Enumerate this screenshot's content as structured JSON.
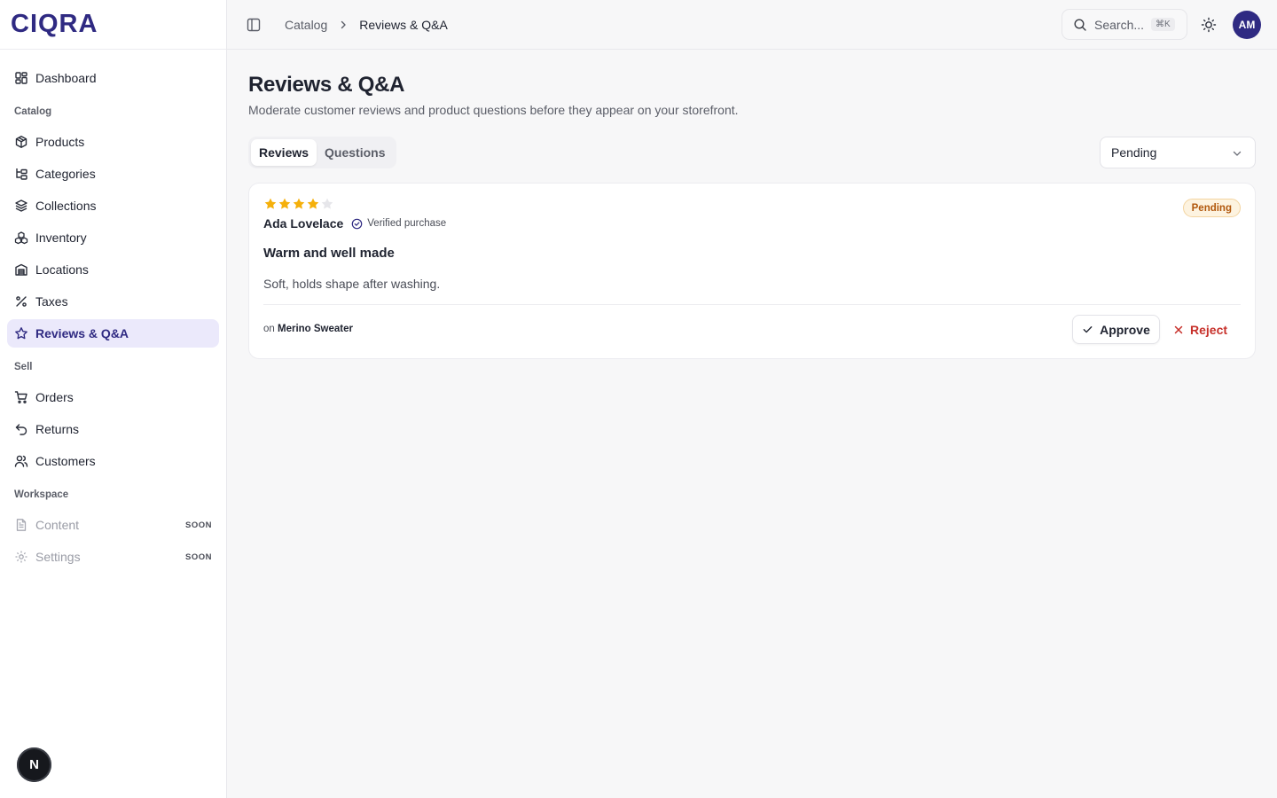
{
  "brand": {
    "logo": "CIQRA"
  },
  "sidebar": {
    "dashboard": "Dashboard",
    "sections": {
      "catalog": "Catalog",
      "sell": "Sell",
      "workspace": "Workspace"
    },
    "catalog_items": {
      "products": "Products",
      "categories": "Categories",
      "collections": "Collections",
      "inventory": "Inventory",
      "locations": "Locations",
      "taxes": "Taxes",
      "reviews": "Reviews & Q&A"
    },
    "sell_items": {
      "orders": "Orders",
      "returns": "Returns",
      "customers": "Customers"
    },
    "workspace_items": {
      "content": "Content",
      "settings": "Settings",
      "soon_label": "SOON"
    },
    "bottom_badge": "N"
  },
  "topbar": {
    "breadcrumb_parent": "Catalog",
    "breadcrumb_current": "Reviews & Q&A",
    "search_placeholder": "Search...",
    "search_shortcut": "⌘K",
    "avatar_initials": "AM"
  },
  "page": {
    "title": "Reviews & Q&A",
    "subtitle": "Moderate customer reviews and product questions before they appear on your storefront.",
    "tabs": {
      "reviews": "Reviews",
      "questions": "Questions"
    },
    "status_filter": "Pending"
  },
  "review": {
    "rating": 4,
    "rating_max": 5,
    "author": "Ada Lovelace",
    "verified_label": "Verified purchase",
    "status": "Pending",
    "title": "Warm and well made",
    "body": "Soft, holds shape after washing.",
    "product_prefix": "on",
    "product_name": "Merino Sweater",
    "approve_label": "Approve",
    "reject_label": "Reject"
  },
  "colors": {
    "accent": "#2f2a82",
    "active_bg": "#ebe9fb",
    "star": "#f5b00b",
    "star_empty": "#e6e6ea",
    "pending_text": "#b1570c",
    "reject": "#c7302a"
  }
}
